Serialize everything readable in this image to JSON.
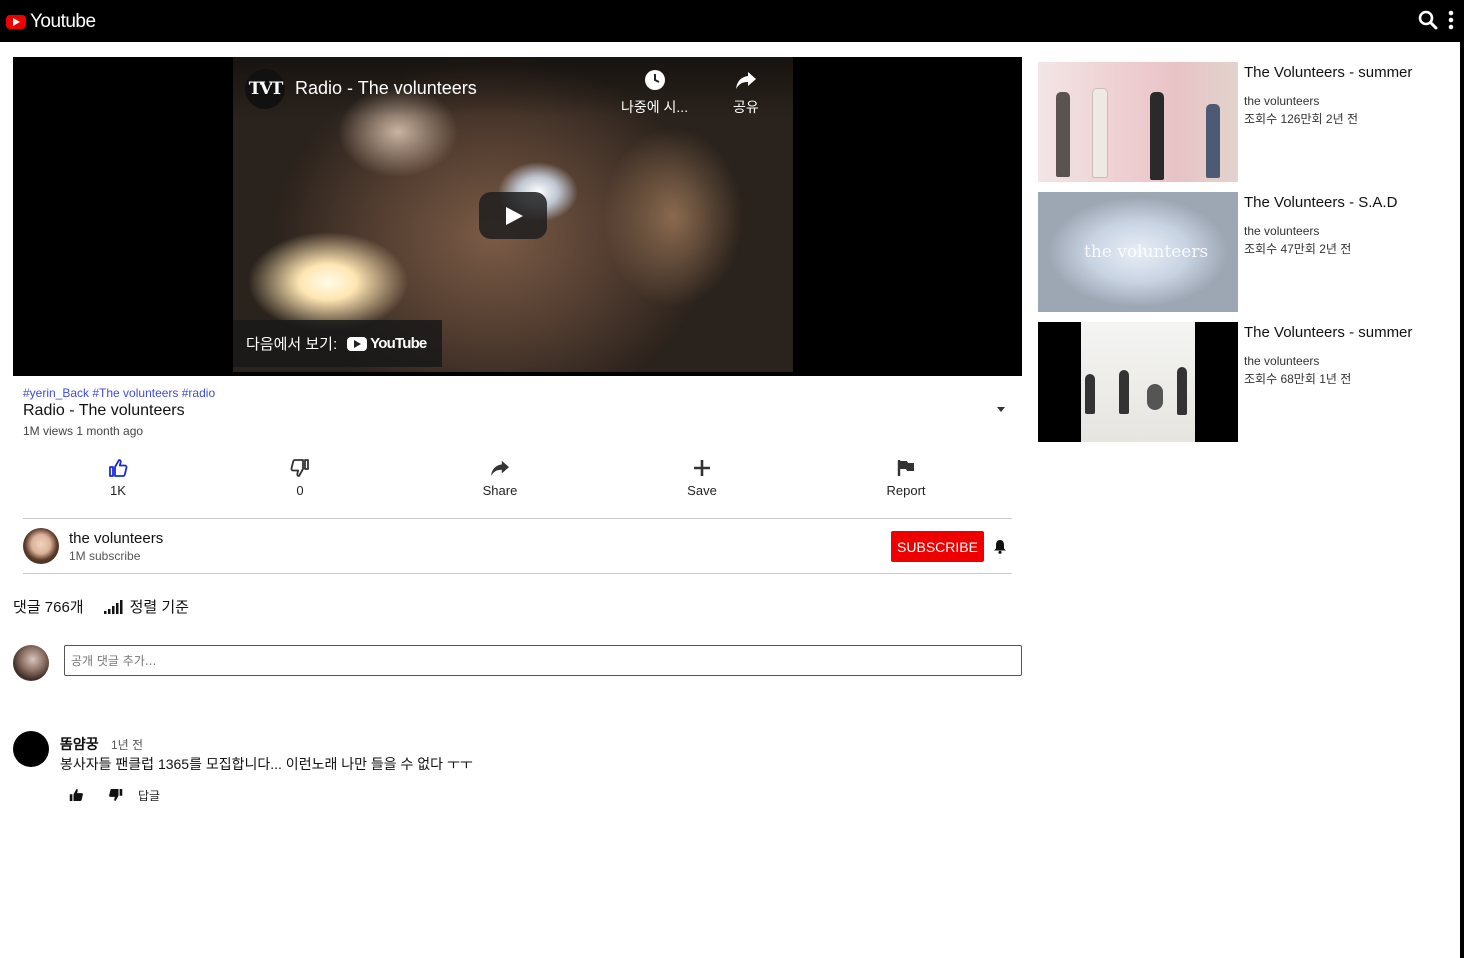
{
  "header": {
    "app_name": "Youtube",
    "icons": [
      "search-icon",
      "more-vert-icon"
    ]
  },
  "video": {
    "embed_title": "Radio - The volunteers",
    "channel_badge": "TVT",
    "watch_later_label": "나중에 시...",
    "share_label": "공유",
    "watch_on_label": "다음에서 보기:",
    "watch_on_brand": "YouTube"
  },
  "info": {
    "hashtags": "#yerin_Back #The volunteers #radio",
    "title": "Radio - The volunteers",
    "views": "1M views 1 month ago"
  },
  "actions": {
    "like": "1K",
    "dislike": "0",
    "share": "Share",
    "save": "Save",
    "report": "Report"
  },
  "channel": {
    "name": "the volunteers",
    "subs": "1M subscribe",
    "subscribe_label": "SUBSCRIBE"
  },
  "comments": {
    "count_label": "댓글 766개",
    "sort_label": "정렬 기준",
    "input_placeholder": "공개 댓글 추가...",
    "items": [
      {
        "author": "똠얌꿍",
        "date": "1년 전",
        "text": "봉사자들 팬클럽 1365를 모집합니다... 이런노래 나만 들을 수 없다 ㅜㅜ",
        "reply_label": "답글"
      }
    ]
  },
  "related": [
    {
      "title": "The Volunteers - summer",
      "channel": "the volunteers",
      "meta": "조회수 126만회 2년 전"
    },
    {
      "title": "The Volunteers - S.A.D",
      "channel": "the volunteers",
      "meta": "조회수 47만회 2년 전",
      "thumb_text": "the volunteers"
    },
    {
      "title": "The Volunteers - summer",
      "channel": "the volunteers",
      "meta": "조회수 68만회 1년 전"
    }
  ],
  "colors": {
    "accent": "#ee0000",
    "link": "#3f4bd8",
    "topbar": "#000000"
  }
}
